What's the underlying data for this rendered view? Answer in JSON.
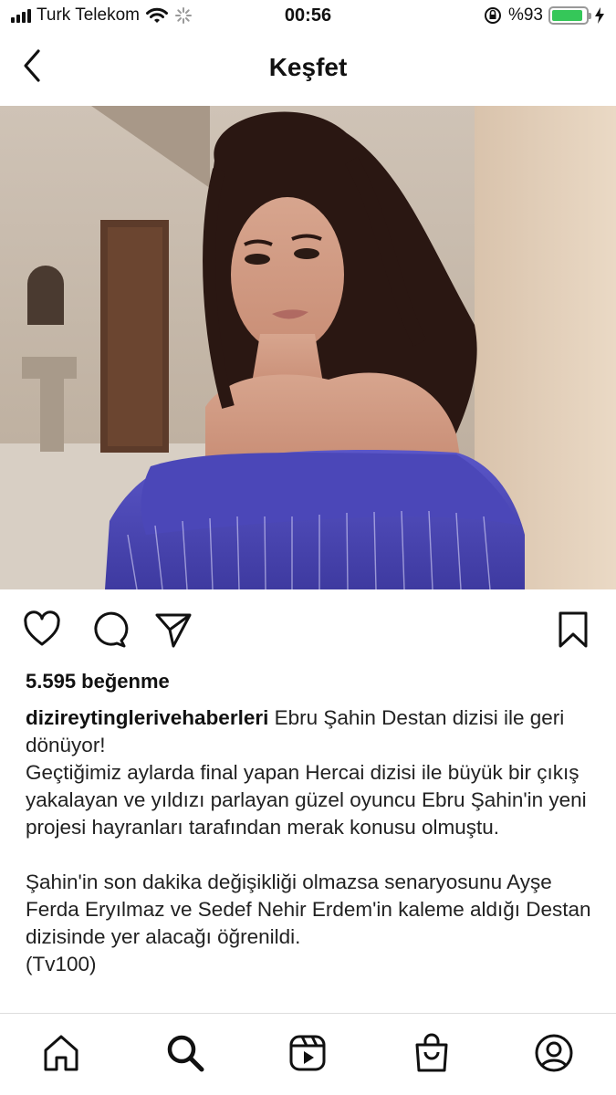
{
  "status_bar": {
    "carrier": "Turk Telekom",
    "time": "00:56",
    "battery_text": "%93",
    "battery_level": 0.93
  },
  "header": {
    "title": "Keşfet"
  },
  "post": {
    "likes": "5.595 beğenme",
    "username": "dizireytinglerivehaberleri",
    "caption_lead": " Ebru Şahin Destan dizisi ile geri dönüyor!",
    "caption_body": "Geçtiğimiz aylarda final yapan Hercai dizisi ile büyük bir çıkış yakalayan ve yıldızı parlayan güzel oyuncu Ebru Şahin'in yeni projesi hayranları tarafından merak konusu olmuştu.\n\nŞahin'in son dakika değişikliği olmazsa senaryosunu Ayşe Ferda Eryılmaz ve Sedef Nehir Erdem'in kaleme aldığı Destan dizisinde yer alacağı öğrenildi.\n(Tv100)"
  },
  "icons": {
    "back": "chevron-left-icon",
    "like": "heart-icon",
    "comment": "comment-icon",
    "share": "send-icon",
    "save": "bookmark-icon",
    "home": "home-icon",
    "search": "search-icon",
    "reels": "reels-icon",
    "shop": "shop-icon",
    "profile": "profile-icon"
  },
  "colors": {
    "battery": "#35c759",
    "text": "#111111"
  }
}
